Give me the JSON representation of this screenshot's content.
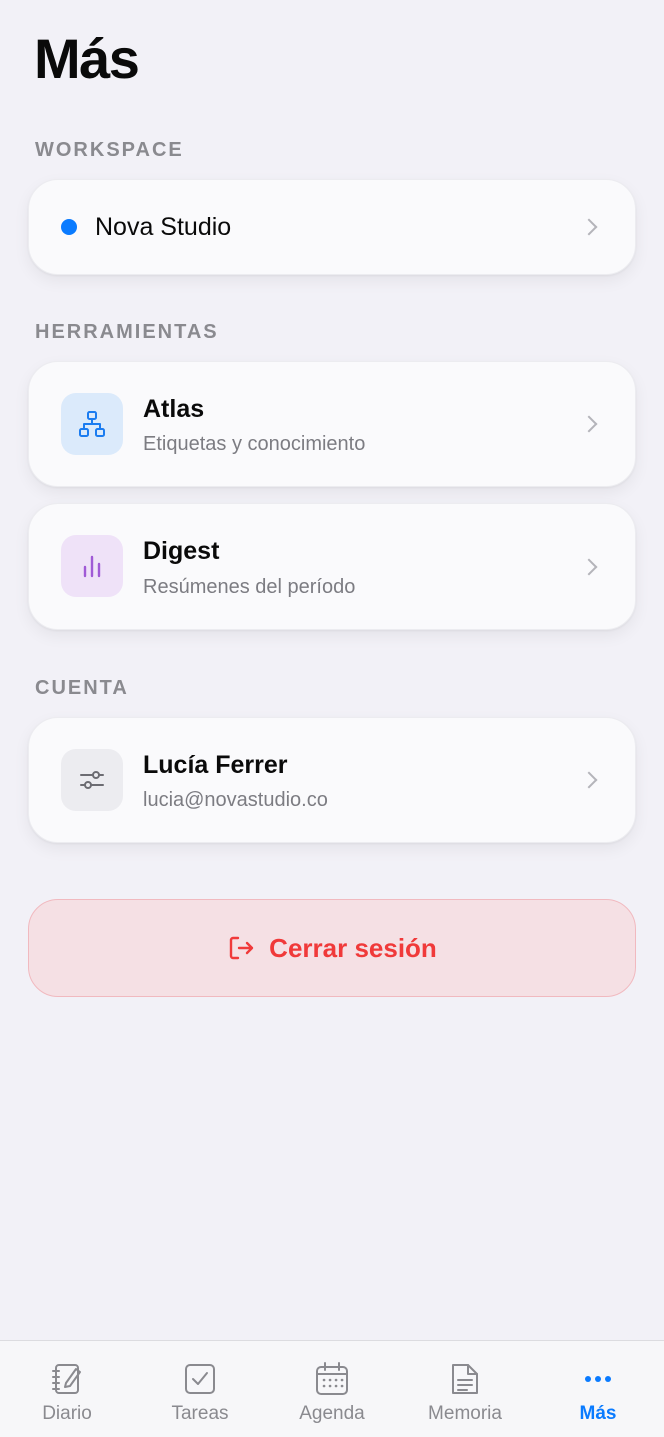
{
  "header": {
    "title": "Más"
  },
  "workspace": {
    "section_label": "WORKSPACE",
    "name": "Nova Studio",
    "dot_color": "#0a7bff"
  },
  "tools": {
    "section_label": "HERRAMIENTAS",
    "items": [
      {
        "title": "Atlas",
        "subtitle": "Etiquetas y conocimiento",
        "icon": "hierarchy-icon",
        "icon_color": "#1b7cf0",
        "icon_bg": "#dbeafb"
      },
      {
        "title": "Digest",
        "subtitle": "Resúmenes del período",
        "icon": "bar-chart-icon",
        "icon_color": "#a05ad6",
        "icon_bg": "#efe2f8"
      }
    ]
  },
  "account": {
    "section_label": "CUENTA",
    "name": "Lucía Ferrer",
    "email": "lucia@novastudio.co",
    "icon": "sliders-icon"
  },
  "logout": {
    "label": "Cerrar sesión",
    "icon": "logout-icon",
    "color": "#f03a3a"
  },
  "tabbar": {
    "active_color": "#0a7bff",
    "items": [
      {
        "label": "Diario",
        "icon": "journal-icon"
      },
      {
        "label": "Tareas",
        "icon": "checkbox-icon"
      },
      {
        "label": "Agenda",
        "icon": "calendar-icon"
      },
      {
        "label": "Memoria",
        "icon": "document-icon"
      },
      {
        "label": "Más",
        "icon": "more-icon",
        "active": true
      }
    ]
  }
}
